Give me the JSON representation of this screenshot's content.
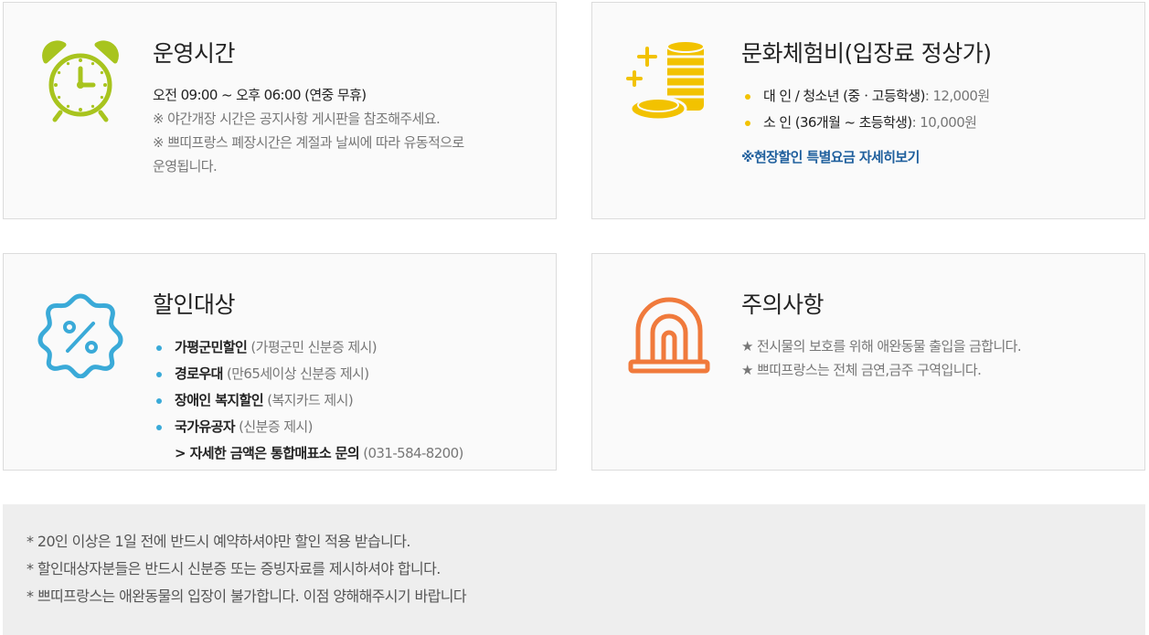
{
  "hours": {
    "title": "운영시간",
    "main": "오전 09:00 ~ 오후 06:00 (연중 무휴)",
    "note1": "※ 야간개장 시간은 공지사항 게시판을 참조해주세요.",
    "note2": "※ 쁘띠프랑스 폐장시간은 계절과 날씨에 따라 유동적으로",
    "note3": "운영됩니다.",
    "icon": "alarm-clock-icon",
    "color": "#a8c41e"
  },
  "fee": {
    "title": "문화체험비(입장료 정상가)",
    "items": [
      {
        "label": "대 인 / 청소년 (중ㆍ고등학생)",
        "price": ": 12,000원"
      },
      {
        "label": "소 인 (36개월 ~ 초등학생)",
        "price": ": 10,000원"
      }
    ],
    "link": "※현장할인 특별요금 자세히보기",
    "icon": "coins-icon",
    "color": "#f2c200"
  },
  "discount": {
    "title": "할인대상",
    "items": [
      {
        "label": "가평군민할인",
        "detail": " (가평군민 신분증 제시)"
      },
      {
        "label": "경로우대",
        "detail": " (만65세이상 신분증 제시)"
      },
      {
        "label": "장애인 복지할인",
        "detail": " (복지카드 제시)"
      },
      {
        "label": "국가유공자",
        "detail": " (신분증 제시)"
      }
    ],
    "more_label": "> 자세한 금액은 통합매표소 문의",
    "more_phone": " (031-584-8200)",
    "icon": "percent-badge-icon",
    "color": "#3aaad8"
  },
  "caution": {
    "title": "주의사항",
    "line1": "★ 전시물의 보호를 위해 애완동물 출입을 금합니다.",
    "line2": "★ 쁘띠프랑스는 전체 금연,금주 구역입니다.",
    "icon": "siren-icon",
    "color": "#f07a3c"
  },
  "notice": {
    "lines": [
      "* 20인 이상은 1일 전에 반드시 예약하셔야만 할인 적용 받습니다.",
      "* 할인대상자분들은 반드시 신분증 또는 증빙자료를 제시하셔야 합니다.",
      "* 쁘띠프랑스는 애완동물의 입장이 불가합니다. 이점 양해해주시기 바랍니다"
    ]
  }
}
